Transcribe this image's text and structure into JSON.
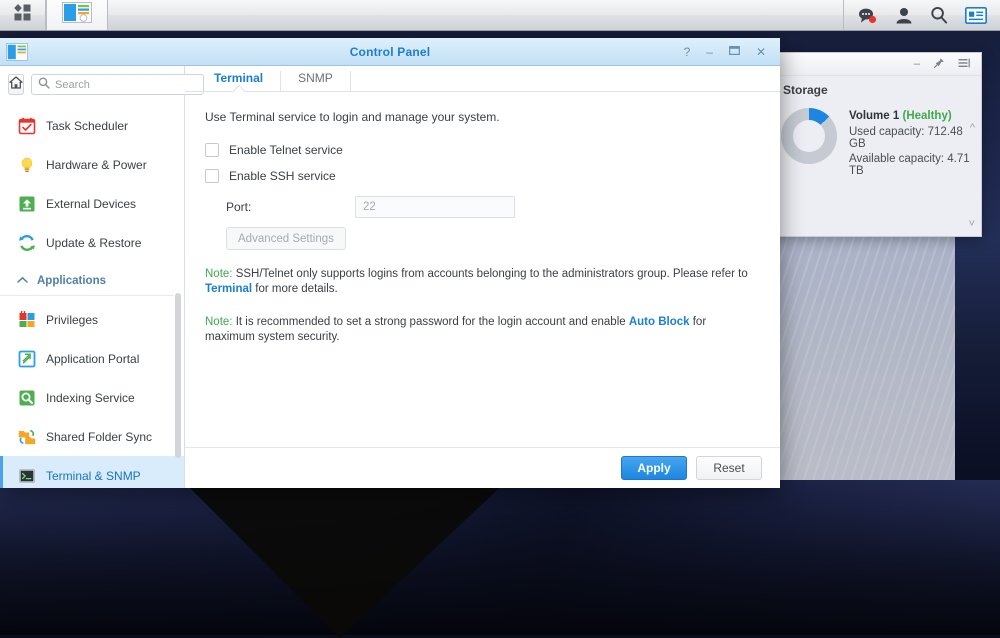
{
  "taskbar": {
    "main_menu_icon": "grid-squares-icon",
    "app_button_icon": "control-panel-icon",
    "right_icons": [
      {
        "name": "chat-icon",
        "badge": true
      },
      {
        "name": "user-icon",
        "badge": false
      },
      {
        "name": "search-icon",
        "badge": false
      },
      {
        "name": "notifications-icon",
        "badge": false
      }
    ]
  },
  "window": {
    "title": "Control Panel",
    "icon": "control-panel-icon",
    "help_label": "?",
    "minimize_label": "–",
    "maximize_label": "❐",
    "close_label": "✕"
  },
  "sidebar": {
    "home_icon": "home-icon",
    "search": {
      "placeholder": "Search",
      "value": ""
    },
    "items": [
      {
        "label": "Task Scheduler",
        "icon": "calendar-check-icon",
        "active": false
      },
      {
        "label": "Hardware & Power",
        "icon": "lightbulb-icon",
        "active": false
      },
      {
        "label": "External Devices",
        "icon": "upload-box-icon",
        "active": false
      },
      {
        "label": "Update & Restore",
        "icon": "refresh-icon",
        "active": false
      }
    ],
    "group": {
      "label": "Applications",
      "collapse_icon": "chevron-up-icon"
    },
    "app_items": [
      {
        "label": "Privileges",
        "icon": "privileges-icon",
        "active": false
      },
      {
        "label": "Application Portal",
        "icon": "app-portal-icon",
        "active": false
      },
      {
        "label": "Indexing Service",
        "icon": "indexing-icon",
        "active": false
      },
      {
        "label": "Shared Folder Sync",
        "icon": "folder-sync-icon",
        "active": false
      },
      {
        "label": "Terminal & SNMP",
        "icon": "terminal-icon",
        "active": true
      }
    ]
  },
  "main": {
    "tabs": [
      {
        "label": "Terminal",
        "active": true
      },
      {
        "label": "SNMP",
        "active": false
      }
    ],
    "intro": "Use Terminal service to login and manage your system.",
    "telnet": {
      "label": "Enable Telnet service",
      "checked": false
    },
    "ssh": {
      "label": "Enable SSH service",
      "checked": false
    },
    "port": {
      "label": "Port:",
      "value": "22",
      "disabled": true
    },
    "advanced_button": {
      "label": "Advanced Settings",
      "disabled": true
    },
    "note1": {
      "tag": "Note:",
      "text_before": " SSH/Telnet only supports logins from accounts belonging to the administrators group. Please refer to ",
      "link": "Terminal",
      "text_after": " for more details."
    },
    "note2": {
      "tag": "Note:",
      "text_before": " It is recommended to set a strong password for the login account and enable ",
      "link": "Auto Block",
      "text_after": " for maximum system security."
    },
    "apply_button": "Apply",
    "reset_button": "Reset"
  },
  "widget": {
    "title": "Storage",
    "volume": "Volume 1",
    "status": "(Healthy)",
    "used": "Used capacity: 712.48 GB",
    "available": "Available capacity: 4.71 TB",
    "minimize_label": "–",
    "pin_icon": "pin-icon",
    "menu_icon": "list-menu-icon",
    "scroll_up_icon": "chevron-up-icon",
    "scroll_down_icon": "chevron-down-icon"
  },
  "colors": {
    "accent": "#1a7fd4",
    "healthy": "#3fa94c",
    "note_tag": "#3fa94c",
    "selected_bg": "#d9ecfb"
  }
}
